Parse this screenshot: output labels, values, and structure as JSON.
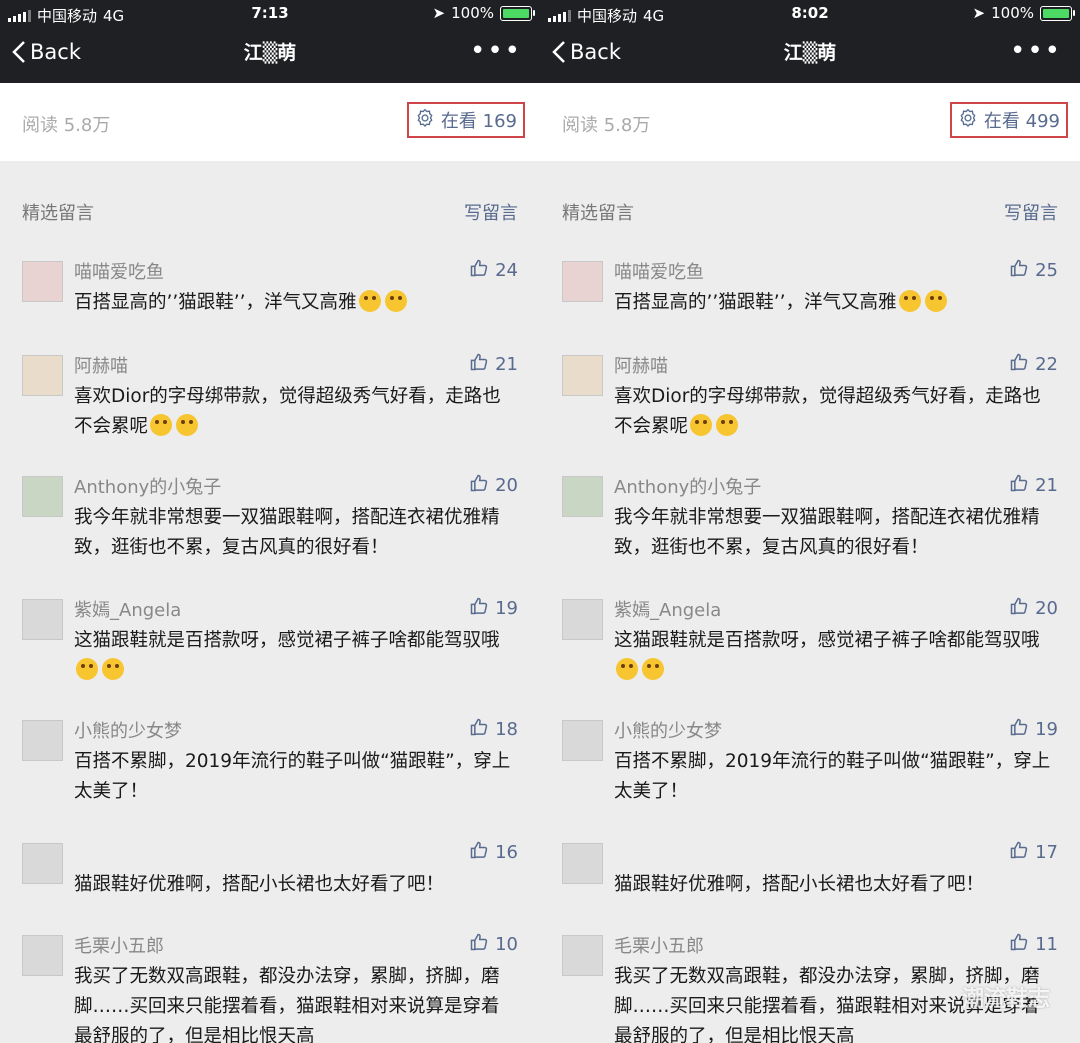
{
  "panels": [
    {
      "status": {
        "carrier": "中国移动",
        "network": "4G",
        "time": "7:13",
        "battery": "100%"
      },
      "nav": {
        "back": "Back",
        "title": "江▒萌"
      },
      "reads": "阅读 5.8万",
      "watching": "在看 169",
      "featured": "精选留言",
      "write": "写留言",
      "comments": [
        {
          "name": "喵喵爱吃鱼",
          "likes": "24",
          "text": "百搭显高的’’猫跟鞋’’，洋气又高雅",
          "emojis": 2
        },
        {
          "name": "阿赫喵",
          "likes": "21",
          "text": "喜欢Dior的字母绑带款，觉得超级秀气好看，走路也不会累呢",
          "emojis": 2
        },
        {
          "name": "Anthony的小兔子",
          "likes": "20",
          "text": "我今年就非常想要一双猫跟鞋啊，搭配连衣裙优雅精致，逛街也不累，复古风真的很好看！",
          "emojis": 0
        },
        {
          "name": "紫嫣_Angela",
          "likes": "19",
          "text": "这猫跟鞋就是百搭款呀，感觉裙子裤子啥都能驾驭哦",
          "emojis": 2
        },
        {
          "name": "小熊的少女梦",
          "likes": "18",
          "text": "百搭不累脚，2019年流行的鞋子叫做“猫跟鞋”，穿上太美了！",
          "emojis": 0
        },
        {
          "name": "",
          "likes": "16",
          "text": "猫跟鞋好优雅啊，搭配小长裙也太好看了吧！",
          "emojis": 0
        },
        {
          "name": "毛栗小五郎",
          "likes": "10",
          "text": "我买了无数双高跟鞋，都没办法穿，累脚，挤脚，磨脚……买回来只能摆着看，猫跟鞋相对来说算是穿着最舒服的了，但是相比恨天高",
          "emojis": 0
        }
      ]
    },
    {
      "status": {
        "carrier": "中国移动",
        "network": "4G",
        "time": "8:02",
        "battery": "100%"
      },
      "nav": {
        "back": "Back",
        "title": "江▒萌"
      },
      "reads": "阅读 5.8万",
      "watching": "在看 499",
      "featured": "精选留言",
      "write": "写留言",
      "comments": [
        {
          "name": "喵喵爱吃鱼",
          "likes": "25",
          "text": "百搭显高的’’猫跟鞋’’，洋气又高雅",
          "emojis": 2
        },
        {
          "name": "阿赫喵",
          "likes": "22",
          "text": "喜欢Dior的字母绑带款，觉得超级秀气好看，走路也不会累呢",
          "emojis": 2
        },
        {
          "name": "Anthony的小兔子",
          "likes": "21",
          "text": "我今年就非常想要一双猫跟鞋啊，搭配连衣裙优雅精致，逛街也不累，复古风真的很好看！",
          "emojis": 0
        },
        {
          "name": "紫嫣_Angela",
          "likes": "20",
          "text": "这猫跟鞋就是百搭款呀，感觉裙子裤子啥都能驾驭哦",
          "emojis": 2
        },
        {
          "name": "小熊的少女梦",
          "likes": "19",
          "text": "百搭不累脚，2019年流行的鞋子叫做“猫跟鞋”，穿上太美了！",
          "emojis": 0
        },
        {
          "name": "",
          "likes": "17",
          "text": "猫跟鞋好优雅啊，搭配小长裙也太好看了吧！",
          "emojis": 0
        },
        {
          "name": "毛栗小五郎",
          "likes": "11",
          "text": "我买了无数双高跟鞋，都没办法穿，累脚，挤脚，磨脚……买回来只能摆着看，猫跟鞋相对来说算是穿着最舒服的了，但是相比恨天高",
          "emojis": 0
        }
      ]
    }
  ],
  "watermark": "潮流鞋志",
  "colors": {
    "bar": "#1f2023",
    "link": "#586a8e",
    "highlight": "#d0454a"
  }
}
